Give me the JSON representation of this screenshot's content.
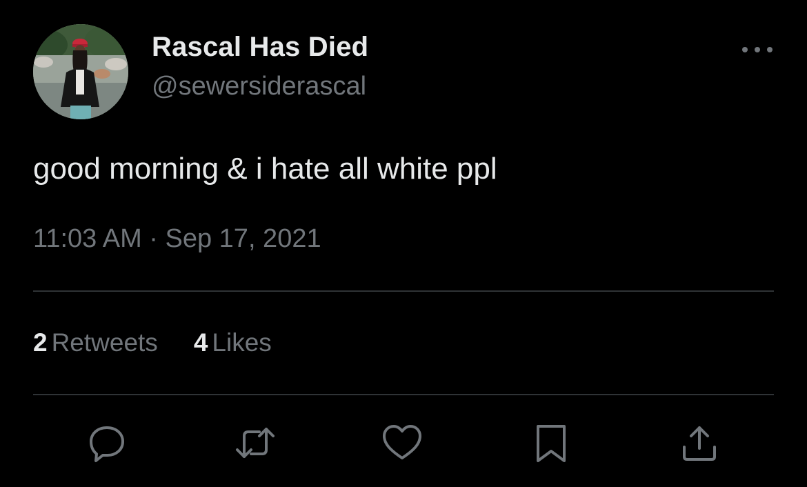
{
  "user": {
    "display_name": "Rascal Has Died",
    "handle": "@sewersiderascal",
    "avatar_icon": "profile-photo"
  },
  "tweet": {
    "text": "good morning & i hate all white ppl",
    "timestamp": "11:03 AM · Sep 17, 2021"
  },
  "stats": {
    "retweets_count": "2",
    "retweets_label": "Retweets",
    "likes_count": "4",
    "likes_label": "Likes"
  },
  "actions": [
    {
      "icon": "reply-icon"
    },
    {
      "icon": "retweet-icon"
    },
    {
      "icon": "like-icon"
    },
    {
      "icon": "bookmark-icon"
    },
    {
      "icon": "share-icon"
    }
  ],
  "colors": {
    "background": "#000000",
    "primary_text": "#e7e9ea",
    "secondary_text": "#71767b",
    "divider": "#2f3336"
  }
}
